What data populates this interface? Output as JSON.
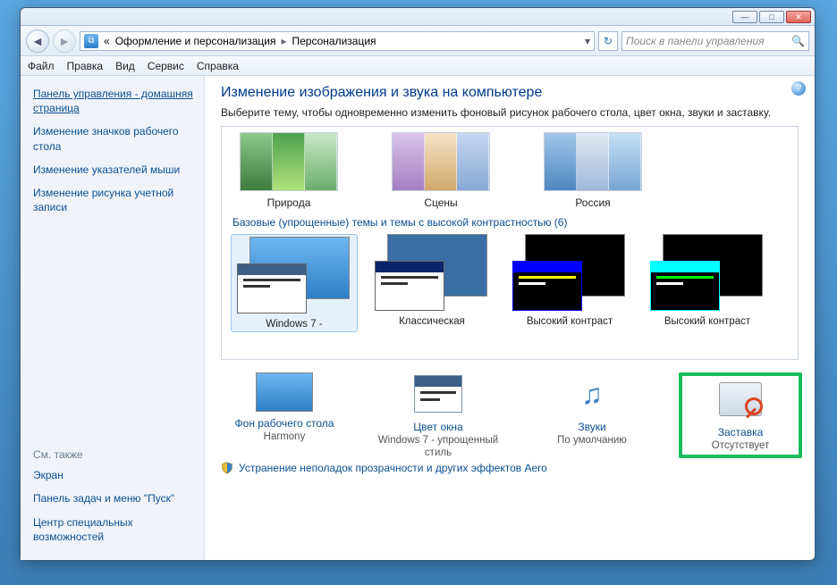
{
  "breadcrumb": {
    "seg1": "Оформление и персонализация",
    "seg2": "Персонализация"
  },
  "searchPlaceholder": "Поиск в панели управления",
  "menu": {
    "file": "Файл",
    "edit": "Правка",
    "view": "Вид",
    "service": "Сервис",
    "help": "Справка"
  },
  "sidebar": {
    "home": "Панель управления - домашняя страница",
    "l1": "Изменение значков рабочего стола",
    "l2": "Изменение указателей мыши",
    "l3": "Изменение рисунка учетной записи",
    "see": "См. также",
    "s1": "Экран",
    "s2": "Панель задач и меню \"Пуск\"",
    "s3": "Центр специальных возможностей"
  },
  "main": {
    "title": "Изменение изображения и звука на компьютере",
    "desc": "Выберите тему, чтобы одновременно изменить фоновый рисунок рабочего стола, цвет окна, звуки и заставку.",
    "aero": {
      "t1": "Природа",
      "t2": "Сцены",
      "t3": "Россия"
    },
    "basicHeader": "Базовые (упрощенные) темы и темы с высокой контрастностью (6)",
    "basic": {
      "b1": "Windows 7 - ",
      "b2": "Классическая",
      "b3": "Высокий контраст",
      "b4": "Высокий контраст"
    }
  },
  "footer": {
    "bg": {
      "label": "Фон рабочего стола",
      "value": "Harmony"
    },
    "col": {
      "label": "Цвет окна",
      "value": "Windows 7 - упрощенный стиль"
    },
    "snd": {
      "label": "Звуки",
      "value": "По умолчанию"
    },
    "scr": {
      "label": "Заставка",
      "value": "Отсутствует"
    }
  },
  "trouble": "Устранение неполадок прозрачности и других эффектов Aero"
}
